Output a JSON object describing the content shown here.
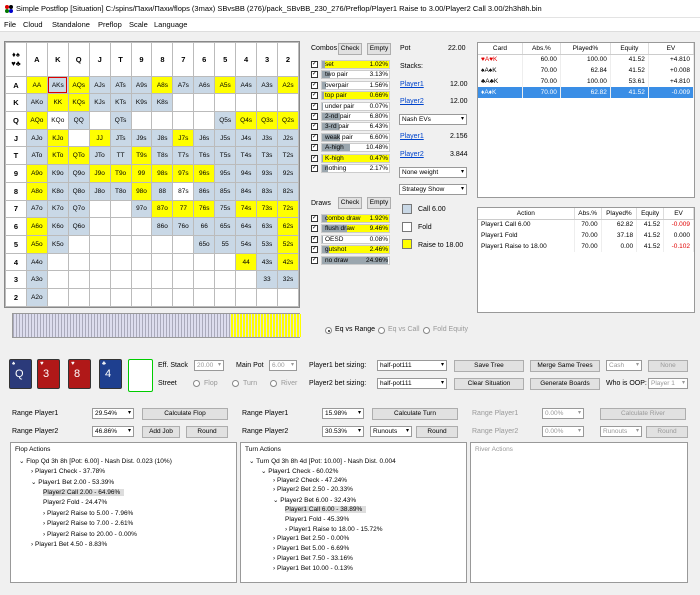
{
  "window": {
    "title": "Simple Postflop [Situation] C:/spins/Пахи/Пахи/flops (3max) SBvsBB (276)/pack_SBvBB_230_276/Preflop/Player1 Raise to 3.00/Player2 Call 3.00/2h3h8h.bin"
  },
  "menu": [
    "File",
    "Cloud",
    "Standalone",
    "Preflop",
    "Scale",
    "Language"
  ],
  "matrix": {
    "cols": [
      "A",
      "K",
      "Q",
      "J",
      "T",
      "9",
      "8",
      "7",
      "6",
      "5",
      "4",
      "3",
      "2"
    ],
    "rows": [
      [
        "AA",
        "AKs",
        "AQs",
        "AJs",
        "ATs",
        "A9s",
        "A8s",
        "A7s",
        "A6s",
        "A5s",
        "A4s",
        "A3s",
        "A2s"
      ],
      [
        "AKo",
        "KK",
        "KQs",
        "KJs",
        "KTs",
        "K9s",
        "K8s",
        "",
        "",
        "",
        "",
        "",
        ""
      ],
      [
        "AQo",
        "KQo",
        "QQ",
        "",
        "QTs",
        "",
        "",
        "",
        "",
        "Q5s",
        "Q4s",
        "Q3s",
        "Q2s"
      ],
      [
        "AJo",
        "KJo",
        "",
        "JJ",
        "JTs",
        "J9s",
        "J8s",
        "J7s",
        "J6s",
        "J5s",
        "J4s",
        "J3s",
        "J2s"
      ],
      [
        "ATo",
        "KTo",
        "QTo",
        "JTo",
        "TT",
        "T9s",
        "T8s",
        "T7s",
        "T6s",
        "T5s",
        "T4s",
        "T3s",
        "T2s"
      ],
      [
        "A9o",
        "K9o",
        "Q9o",
        "J9o",
        "T9o",
        "99",
        "98s",
        "97s",
        "96s",
        "95s",
        "94s",
        "93s",
        "92s"
      ],
      [
        "A8o",
        "K8o",
        "Q8o",
        "J8o",
        "T8o",
        "98o",
        "88",
        "87s",
        "86s",
        "85s",
        "84s",
        "83s",
        "82s"
      ],
      [
        "A7o",
        "K7o",
        "Q7o",
        "",
        "",
        "97o",
        "87o",
        "77",
        "76s",
        "75s",
        "74s",
        "73s",
        "72s"
      ],
      [
        "A6o",
        "K6o",
        "Q6o",
        "",
        "",
        "",
        "86o",
        "76o",
        "66",
        "65s",
        "64s",
        "63s",
        "62s"
      ],
      [
        "A5o",
        "K5o",
        "",
        "",
        "",
        "",
        "",
        "",
        "65o",
        "55",
        "54s",
        "53s",
        "52s"
      ],
      [
        "A4o",
        "",
        "",
        "",
        "",
        "",
        "",
        "",
        "",
        "",
        "44",
        "43s",
        "42s"
      ],
      [
        "A3o",
        "",
        "",
        "",
        "",
        "",
        "",
        "",
        "",
        "",
        "",
        "33",
        "32s"
      ],
      [
        "A2o",
        "",
        "",
        "",
        "",
        "",
        "",
        "",
        "",
        "",
        "",
        "",
        ""
      ]
    ]
  },
  "combos": {
    "title": "Combos",
    "check": "Check",
    "empty": "Empty",
    "rows": [
      {
        "name": "set",
        "pct": "1.02%",
        "v": 1.02
      },
      {
        "name": "two pair",
        "pct": "3.13%",
        "v": 3.13
      },
      {
        "name": "overpair",
        "pct": "1.56%",
        "v": 1.56
      },
      {
        "name": "top pair",
        "pct": "0.66%",
        "v": 0.66
      },
      {
        "name": "under pair",
        "pct": "0.07%",
        "v": 0.07
      },
      {
        "name": "2-nd pair",
        "pct": "6.80%",
        "v": 6.8
      },
      {
        "name": "3-rd pair",
        "pct": "6.43%",
        "v": 6.43
      },
      {
        "name": "weak pair",
        "pct": "6.60%",
        "v": 6.6
      },
      {
        "name": "A-high",
        "pct": "10.48%",
        "v": 10.48
      },
      {
        "name": "K-high",
        "pct": "0.47%",
        "v": 0.47
      },
      {
        "name": "nothing",
        "pct": "2.17%",
        "v": 2.17
      }
    ]
  },
  "draws": {
    "title": "Draws",
    "check": "Check",
    "empty": "Empty",
    "rows": [
      {
        "name": "combo draw",
        "pct": "1.92%",
        "v": 1.92
      },
      {
        "name": "flush draw",
        "pct": "9.46%",
        "v": 9.46
      },
      {
        "name": "OESD",
        "pct": "0.08%",
        "v": 0.08
      },
      {
        "name": "gutshot",
        "pct": "2.46%",
        "v": 2.46
      },
      {
        "name": "no draw",
        "pct": "24.96%",
        "v": 24.96
      }
    ]
  },
  "pot": {
    "label": "Pot",
    "value": "22.00",
    "stacks": "Stacks:",
    "p1": "Player1",
    "p1v": "12.00",
    "p2": "Player2",
    "p2v": "12.00",
    "nash": "Nash EVs",
    "p1ev": "2.156",
    "p2ev": "3.844",
    "weight": "None weight",
    "strat": "Strategy Show"
  },
  "legend": {
    "call": "Call 6.00",
    "fold": "Fold",
    "raise": "Raise to 18.00"
  },
  "cardtable": {
    "headers": [
      "Card",
      "Abs.%",
      "Played%",
      "Equity",
      "EV"
    ],
    "rows": [
      {
        "card": "♥A♥K",
        "abs": "60.00",
        "played": "100.00",
        "eq": "41.52",
        "ev": "+4.810"
      },
      {
        "card": "♠A♠K",
        "abs": "70.00",
        "played": "62.84",
        "eq": "41.52",
        "ev": "+0.008"
      },
      {
        "card": "♣A♣K",
        "abs": "70.00",
        "played": "100.00",
        "eq": "53.61",
        "ev": "+4.810"
      },
      {
        "card": "♦A♦K",
        "abs": "70.00",
        "played": "62.82",
        "eq": "41.52",
        "ev": "-0.009"
      }
    ]
  },
  "actiontable": {
    "headers": [
      "Action",
      "Abs.%",
      "Played%",
      "Equity",
      "EV"
    ],
    "rows": [
      {
        "a": "Player1 Call 6.00",
        "abs": "70.00",
        "played": "62.82",
        "eq": "41.52",
        "ev": "-0.009"
      },
      {
        "a": "Player1 Fold",
        "abs": "70.00",
        "played": "37.18",
        "eq": "41.52",
        "ev": "0.000"
      },
      {
        "a": "Player1 Raise to 18.00",
        "abs": "70.00",
        "played": "0.00",
        "eq": "41.52",
        "ev": "-0.102"
      }
    ]
  },
  "eqmode": [
    "Eq vs Range",
    "Eq vs Call",
    "Fold Equity"
  ],
  "board": [
    {
      "r": "Q",
      "s": "♠"
    },
    {
      "r": "3",
      "s": "♥"
    },
    {
      "r": "8",
      "s": "♥"
    },
    {
      "r": "4",
      "s": "♣"
    }
  ],
  "controls": {
    "effstack": "Eff. Stack",
    "effv": "20.00",
    "mainpot": "Main Pot",
    "mainv": "6.00",
    "street": "Street",
    "flop": "Flop",
    "turn": "Turn",
    "river": "River",
    "p1bet": "Player1 bet sizing:",
    "p2bet": "Player2 bet sizing:",
    "halfpot": "half-pot111",
    "savetree": "Save Tree",
    "mergetrees": "Merge Same Trees",
    "cash": "Cash",
    "none": "None",
    "clearsit": "Clear Situation",
    "genboards": "Generate Boards",
    "whooop": "Who is OOP:",
    "oopv": "Player 1"
  },
  "ranges": {
    "rp1": "Range Player1",
    "rp2": "Range Player2",
    "f1": "29.54%",
    "f2": "46.86%",
    "calcflop": "Calculate Flop",
    "addjob": "Add Job",
    "round": "Round",
    "t1": "15.98%",
    "t2": "30.53%",
    "calcturn": "Calculate Turn",
    "runouts": "Runouts",
    "r1": "0.00%",
    "r2": "0.00%",
    "calcriver": "Calculate River"
  },
  "flop": {
    "title": "Flop Actions",
    "lines": [
      "Flop Qd 3h 8h [Pot: 6.00] - Nash Dist. 0.023 (10%)",
      "Player1 Check - 37.78%",
      "Player1 Bet 2.00 - 53.39%",
      "Player2 Call 2.00 - 64.96%",
      "Player2 Fold - 24.47%",
      "Player2 Raise to 5.00 - 7.96%",
      "Player2 Raise to 7.00 - 2.61%",
      "Player2 Raise to 20.00 - 0.00%",
      "Player1 Bet 4.50 - 8.83%"
    ]
  },
  "turn": {
    "title": "Turn Actions",
    "lines": [
      "Turn Qd 3h 8h 4d [Pot: 10.00] - Nash Dist. 0.004",
      "Player1 Check - 60.02%",
      "Player2 Check - 47.24%",
      "Player2 Bet 2.50 - 20.33%",
      "Player2 Bet 6.00 - 32.43%",
      "Player1 Call 6.00 - 38.89%",
      "Player1 Fold - 45.39%",
      "Player1 Raise to 18.00 - 15.72%",
      "Player1 Bet 2.50 - 0.00%",
      "Player1 Bet 5.00 - 6.69%",
      "Player1 Bet 7.50 - 33.16%",
      "Player1 Bet 10.00 - 0.13%"
    ]
  },
  "river": {
    "title": "River Actions"
  }
}
